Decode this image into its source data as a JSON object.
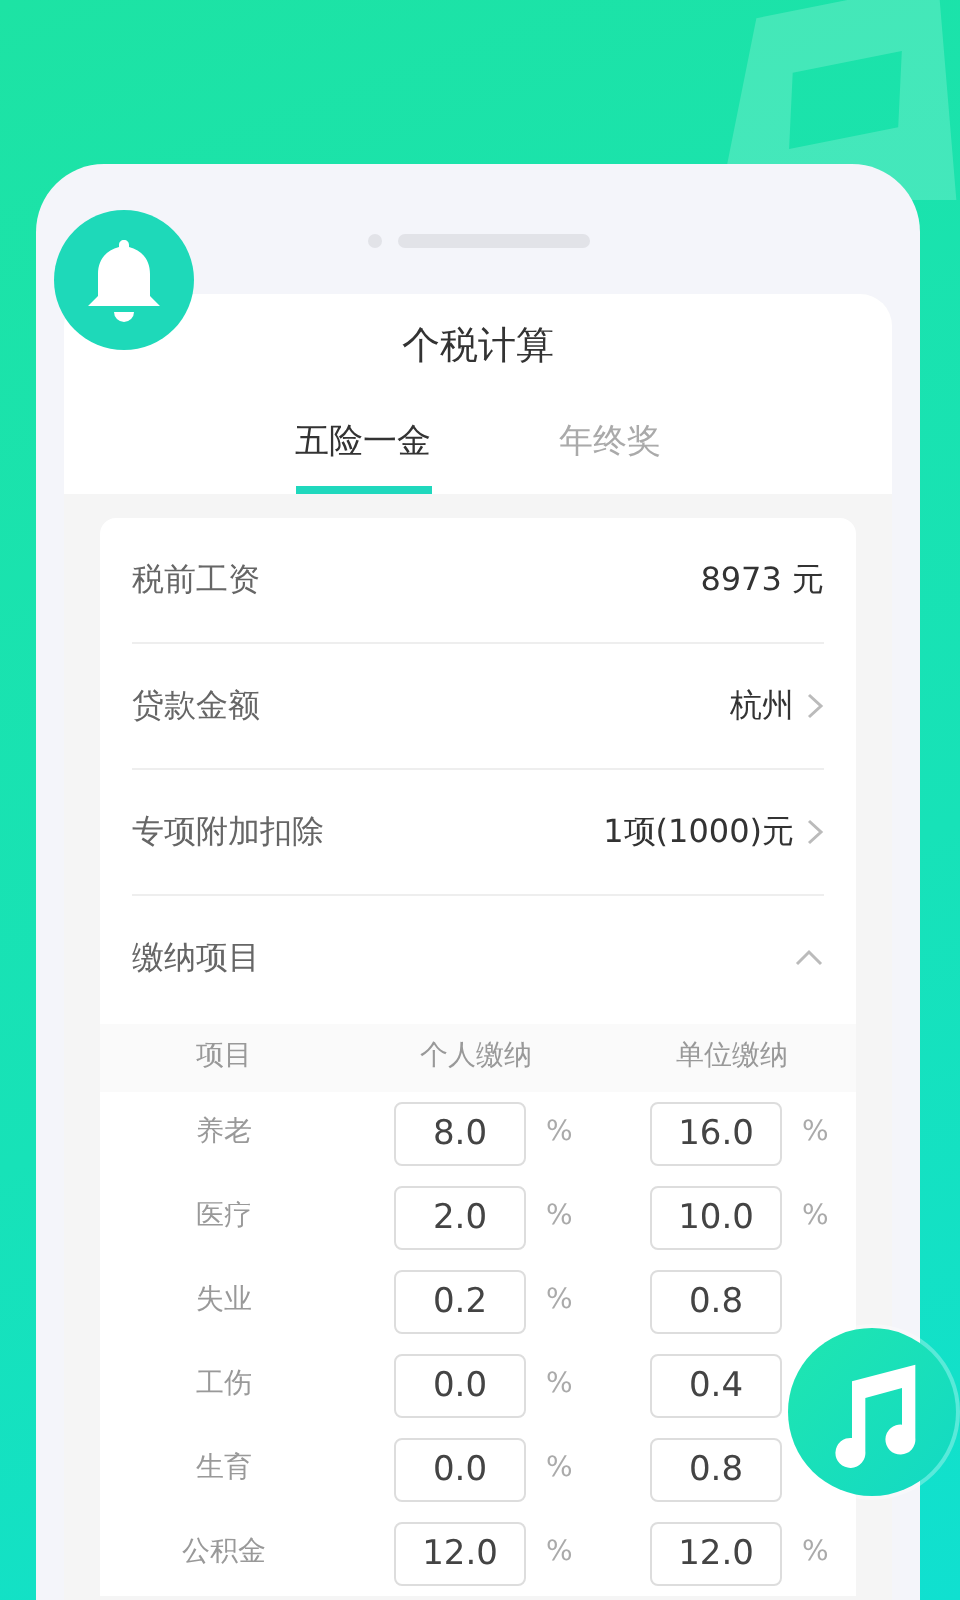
{
  "header": {
    "title": "个税计算"
  },
  "tabs": [
    {
      "label": "五险一金",
      "selected": true
    },
    {
      "label": "年终奖",
      "selected": false
    }
  ],
  "fields": [
    {
      "label": "税前工资",
      "value": "8973 元",
      "kind": "text"
    },
    {
      "label": "贷款金额",
      "value": "杭州",
      "kind": "link"
    },
    {
      "label": "专项附加扣除",
      "value": "1项(1000)元",
      "kind": "link"
    }
  ],
  "section": {
    "label": "缴纳项目",
    "expanded": true
  },
  "table": {
    "columns": [
      "项目",
      "个人缴纳",
      "单位缴纳"
    ],
    "rows": [
      {
        "item": "养老",
        "personal": "8.0",
        "personal_unit": "%",
        "company": "16.0",
        "company_unit": "%"
      },
      {
        "item": "医疗",
        "personal": "2.0",
        "personal_unit": "%",
        "company": "10.0",
        "company_unit": "%"
      },
      {
        "item": "失业",
        "personal": "0.2",
        "personal_unit": "%",
        "company": "0.8"
      },
      {
        "item": "工伤",
        "personal": "0.0",
        "personal_unit": "%",
        "company": "0.4"
      },
      {
        "item": "生育",
        "personal": "0.0",
        "personal_unit": "%",
        "company": "0.8"
      },
      {
        "item": "公积金",
        "personal": "12.0",
        "personal_unit": "%",
        "company": "12.0",
        "company_unit": "%"
      }
    ]
  }
}
